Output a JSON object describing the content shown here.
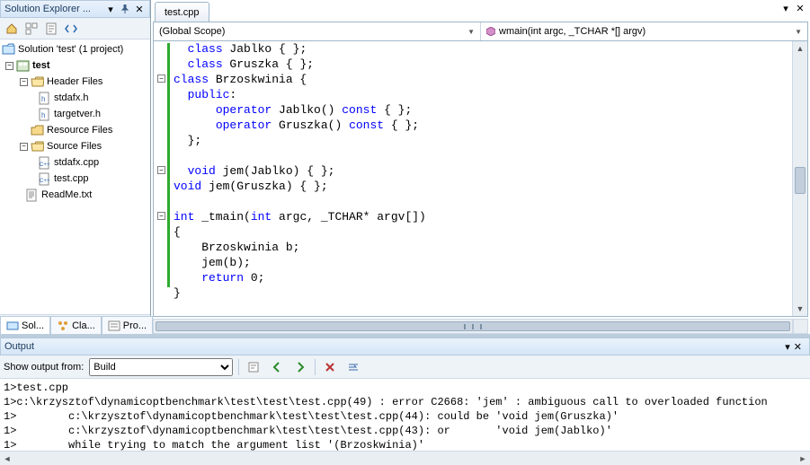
{
  "explorer": {
    "title": "Solution Explorer ...",
    "solution_label": "Solution 'test' (1 project)",
    "project_label": "test",
    "folders": {
      "header": "Header Files",
      "resource": "Resource Files",
      "source": "Source Files"
    },
    "files": {
      "stdafx_h": "stdafx.h",
      "targetver_h": "targetver.h",
      "stdafx_cpp": "stdafx.cpp",
      "test_cpp": "test.cpp",
      "readme": "ReadMe.txt"
    },
    "tabs": {
      "sol": "Sol...",
      "cla": "Cla...",
      "pro": "Pro..."
    }
  },
  "editor": {
    "file_tab": "test.cpp",
    "scope_left": "(Global Scope)",
    "scope_right": "wmain(int argc, _TCHAR *[] argv)",
    "code": {
      "l1": {
        "t1": "class",
        "t2": " Jablko { };"
      },
      "l2": {
        "t1": "class",
        "t2": " Gruszka { };"
      },
      "l3": {
        "t1": "class",
        "t2": " Brzoskwinia {"
      },
      "l4": {
        "t1": "public",
        "t2": ":"
      },
      "l5": {
        "t1": "operator",
        "t2": " Jablko() ",
        "t3": "const",
        "t4": " { };"
      },
      "l6": {
        "t1": "operator",
        "t2": " Gruszka() ",
        "t3": "const",
        "t4": " { };"
      },
      "l7": "};",
      "l8": {
        "t1": "void",
        "t2": " jem(Jablko) { };"
      },
      "l9": {
        "t1": "void",
        "t2": " jem(Gruszka) { };"
      },
      "l10": {
        "t1": "int",
        "t2": " _tmain(",
        "t3": "int",
        "t4": " argc, _TCHAR* argv[])"
      },
      "l11": "{",
      "l12": "    Brzoskwinia b;",
      "l13": "    jem(b);",
      "l14": {
        "t1": "return",
        "t2": " 0;"
      },
      "l15": "}"
    }
  },
  "output": {
    "title": "Output",
    "show_label": "Show output from:",
    "source_selected": "Build",
    "lines": {
      "l1": "1>test.cpp",
      "l2": "1>c:\\krzysztof\\dynamicoptbenchmark\\test\\test\\test.cpp(49) : error C2668: 'jem' : ambiguous call to overloaded function",
      "l3": "1>        c:\\krzysztof\\dynamicoptbenchmark\\test\\test\\test.cpp(44): could be 'void jem(Gruszka)'",
      "l4": "1>        c:\\krzysztof\\dynamicoptbenchmark\\test\\test\\test.cpp(43): or       'void jem(Jablko)'",
      "l5": "1>        while trying to match the argument list '(Brzoskwinia)'"
    }
  }
}
